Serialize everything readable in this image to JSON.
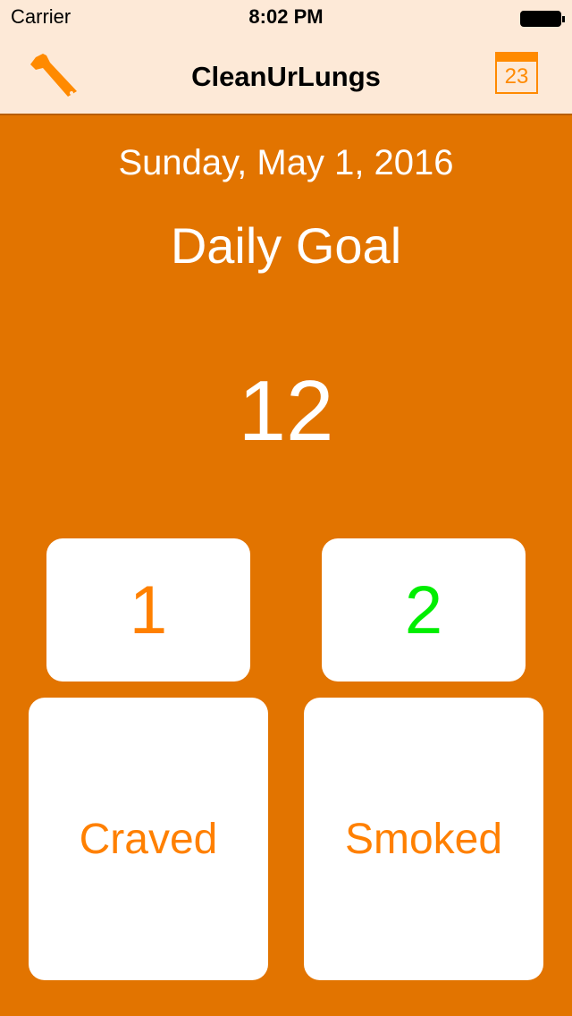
{
  "status": {
    "carrier": "Carrier",
    "time": "8:02 PM"
  },
  "nav": {
    "title": "CleanUrLungs",
    "calendar_day": "23"
  },
  "main": {
    "date": "Sunday, May 1, 2016",
    "goal_label": "Daily Goal",
    "goal_value": "12",
    "craved_count": "1",
    "smoked_count": "2",
    "craved_label": "Craved",
    "smoked_label": "Smoked"
  },
  "colors": {
    "background": "#e27400",
    "accent": "#ff8000",
    "smoked_count": "#00ee00"
  }
}
